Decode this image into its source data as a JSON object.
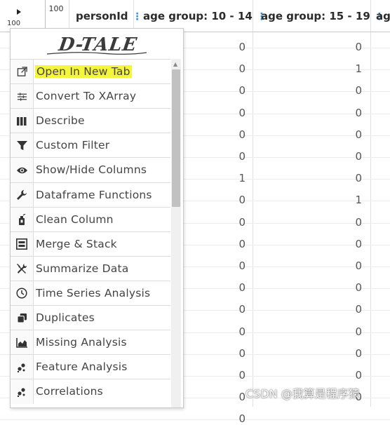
{
  "grid": {
    "corner_count": "100",
    "corner_count_small": "100",
    "columns": [
      "personId",
      "age group: 10 - 14",
      "age group: 15 - 19",
      "ag"
    ],
    "col1_values": [
      "0",
      "0",
      "0",
      "0",
      "0",
      "0",
      "1",
      "0",
      "0",
      "0",
      "0",
      "0",
      "0",
      "0",
      "0",
      "0",
      "0",
      "0"
    ],
    "col2_values": [
      "0",
      "1",
      "0",
      "0",
      "0",
      "0",
      "0",
      "1",
      "0",
      "0",
      "0",
      "0",
      "0",
      "0",
      "0",
      "0",
      "0"
    ]
  },
  "menu": {
    "logo": "D-TALE",
    "items": [
      {
        "label": "Open In New Tab",
        "icon": "external-link-icon"
      },
      {
        "label": "Convert To XArray",
        "icon": "sliders-icon"
      },
      {
        "label": "Describe",
        "icon": "columns-icon"
      },
      {
        "label": "Custom Filter",
        "icon": "filter-icon"
      },
      {
        "label": "Show/Hide Columns",
        "icon": "eye-icon"
      },
      {
        "label": "Dataframe Functions",
        "icon": "wrench-icon"
      },
      {
        "label": "Clean Column",
        "icon": "spray-icon"
      },
      {
        "label": "Merge & Stack",
        "icon": "merge-icon"
      },
      {
        "label": "Summarize Data",
        "icon": "tools-icon"
      },
      {
        "label": "Time Series Analysis",
        "icon": "clock-icon"
      },
      {
        "label": "Duplicates",
        "icon": "clone-icon"
      },
      {
        "label": "Missing Analysis",
        "icon": "area-chart-icon"
      },
      {
        "label": "Feature Analysis",
        "icon": "scatter-icon"
      },
      {
        "label": "Correlations",
        "icon": "scatter-icon"
      }
    ]
  },
  "watermark": "CSDN @我算是程序猿",
  "colors": {
    "highlight": "#f5f53a",
    "accent": "#2f8fe0"
  }
}
